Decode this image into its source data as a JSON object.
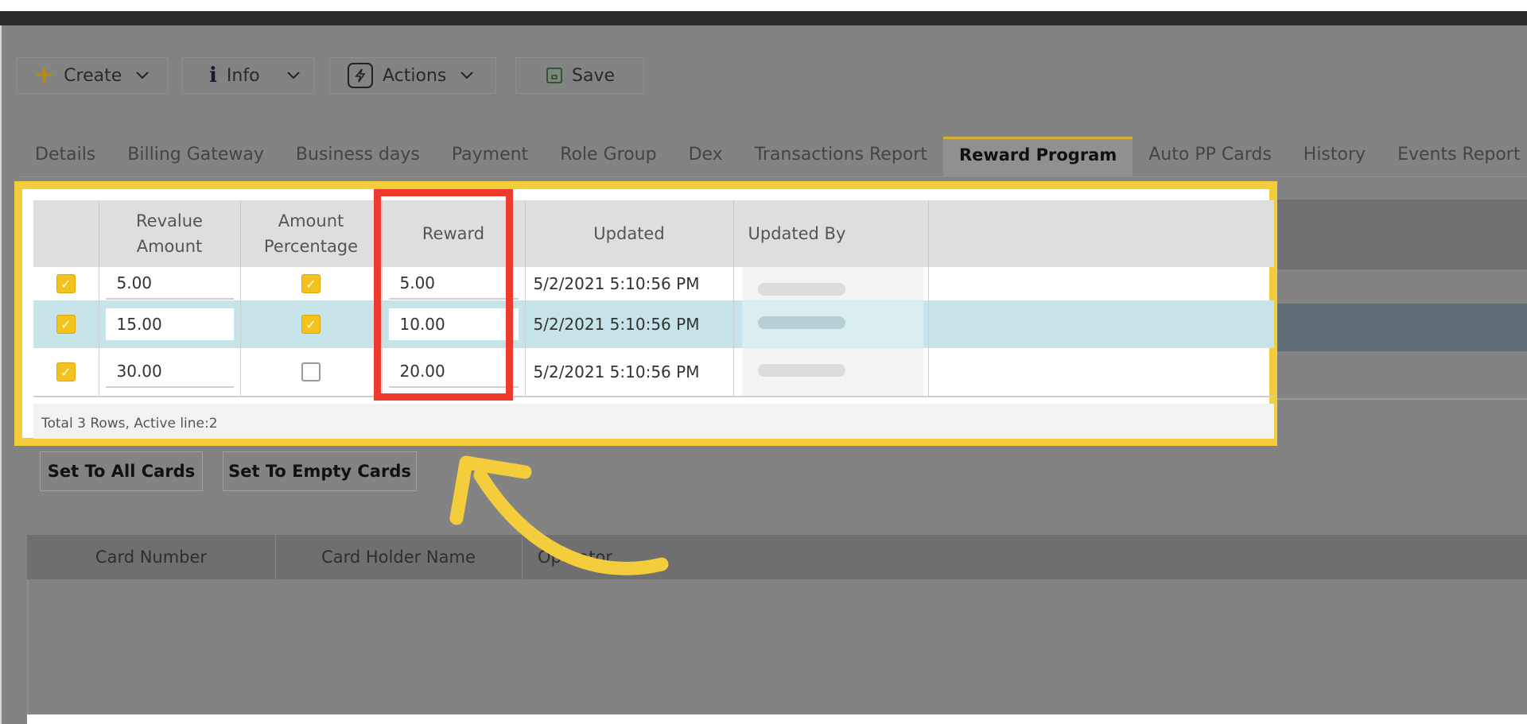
{
  "toolbar": {
    "create_label": "Create",
    "info_label": "Info",
    "actions_label": "Actions",
    "save_label": "Save"
  },
  "tabs": [
    {
      "label": "Details"
    },
    {
      "label": "Billing Gateway"
    },
    {
      "label": "Business days"
    },
    {
      "label": "Payment"
    },
    {
      "label": "Role Group"
    },
    {
      "label": "Dex"
    },
    {
      "label": "Transactions Report"
    },
    {
      "label": "Reward Program",
      "active": true
    },
    {
      "label": "Auto PP Cards"
    },
    {
      "label": "History"
    },
    {
      "label": "Events Report"
    }
  ],
  "reward_table": {
    "headers": {
      "revalue_line1": "Revalue",
      "revalue_line2": "Amount",
      "pct_line1": "Amount",
      "pct_line2": "Percentage",
      "reward": "Reward",
      "updated": "Updated",
      "updated_by": "Updated By"
    },
    "rows": [
      {
        "checked": true,
        "revalue": "5.00",
        "pct": true,
        "reward": "5.00",
        "updated": "5/2/2021 5:10:56 PM"
      },
      {
        "checked": true,
        "revalue": "15.00",
        "pct": true,
        "reward": "10.00",
        "updated": "5/2/2021 5:10:56 PM",
        "active": true
      },
      {
        "checked": true,
        "revalue": "30.00",
        "pct": false,
        "reward": "20.00",
        "updated": "5/2/2021 5:10:56 PM"
      }
    ],
    "footer": "Total 3 Rows, Active line:2"
  },
  "buttons": {
    "set_all": "Set To All Cards",
    "set_empty": "Set To Empty Cards"
  },
  "cards_table": {
    "headers": {
      "card_number": "Card Number",
      "holder": "Card Holder Name",
      "operator": "Operator"
    }
  },
  "colors": {
    "highlight_yellow": "#f4cd3c",
    "highlight_red": "#ef3a2f",
    "checkbox_yellow": "#f4c21c",
    "active_row": "#c5e3e8"
  }
}
